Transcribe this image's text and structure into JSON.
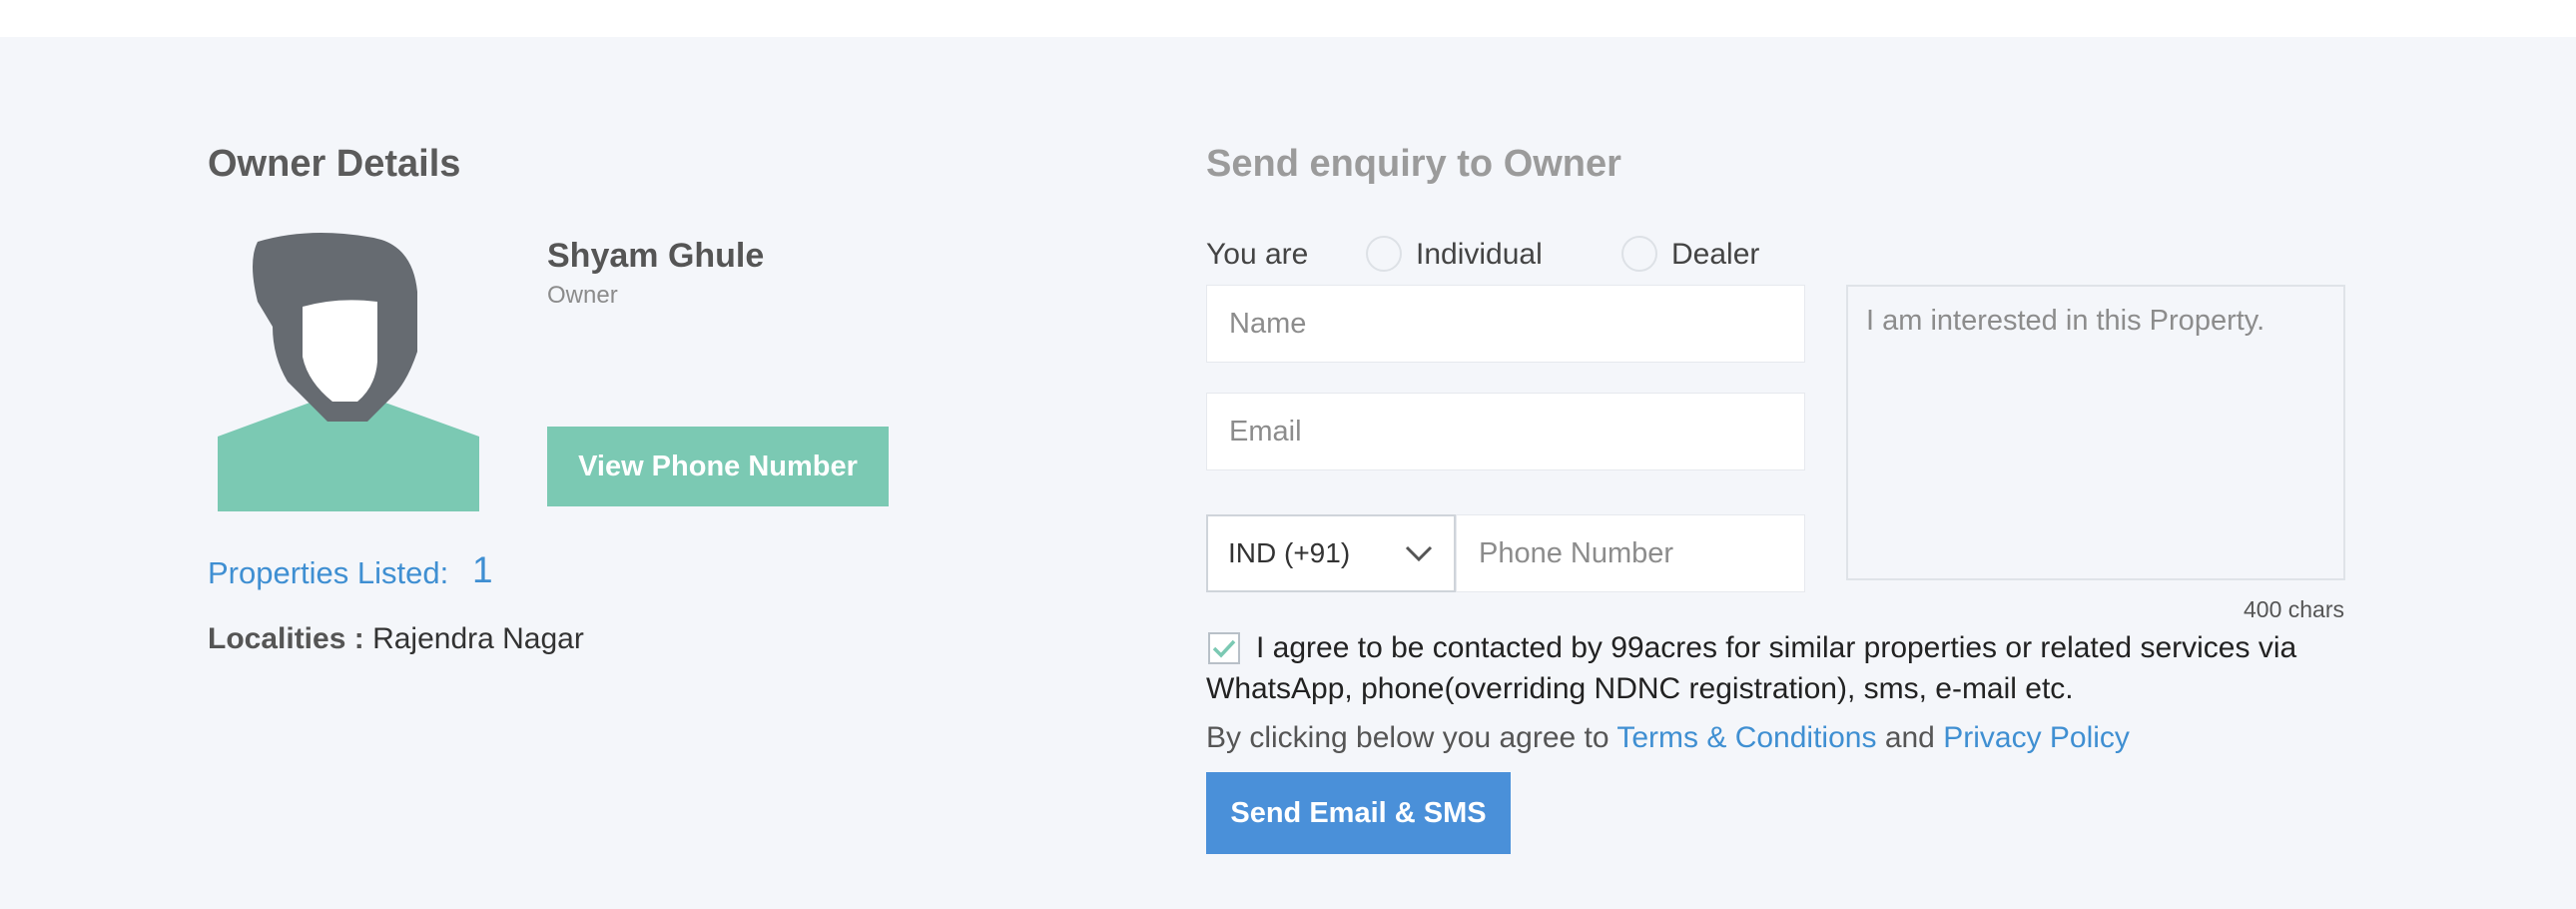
{
  "owner": {
    "section_title": "Owner Details",
    "name": "Shyam Ghule",
    "role": "Owner",
    "view_phone_label": "View Phone Number",
    "properties_listed_label": "Properties Listed:",
    "properties_listed_count": "1",
    "localities_label": "Localities :",
    "localities_value": "Rajendra Nagar"
  },
  "enquiry": {
    "section_title": "Send enquiry to Owner",
    "you_are_label": "You are",
    "options": [
      "Individual",
      "Dealer"
    ],
    "name_placeholder": "Name",
    "email_placeholder": "Email",
    "country_code": "IND (+91)",
    "phone_placeholder": "Phone Number",
    "message_placeholder": "I am interested in this Property.",
    "chars_remaining": "400 chars",
    "consent_checked": true,
    "consent_text": "I agree to be contacted by 99acres for similar properties or related services via WhatsApp, phone(overriding NDNC registration), sms, e-mail etc.",
    "terms_prefix": "By clicking below you agree to",
    "terms_link": "Terms & Conditions",
    "terms_and": "and",
    "privacy_link": "Privacy Policy",
    "submit_label": "Send Email & SMS"
  },
  "colors": {
    "accent_green": "#7bc9b3",
    "accent_blue": "#4a90d9",
    "link_blue": "#3f8fd2",
    "background": "#f4f6fa"
  }
}
